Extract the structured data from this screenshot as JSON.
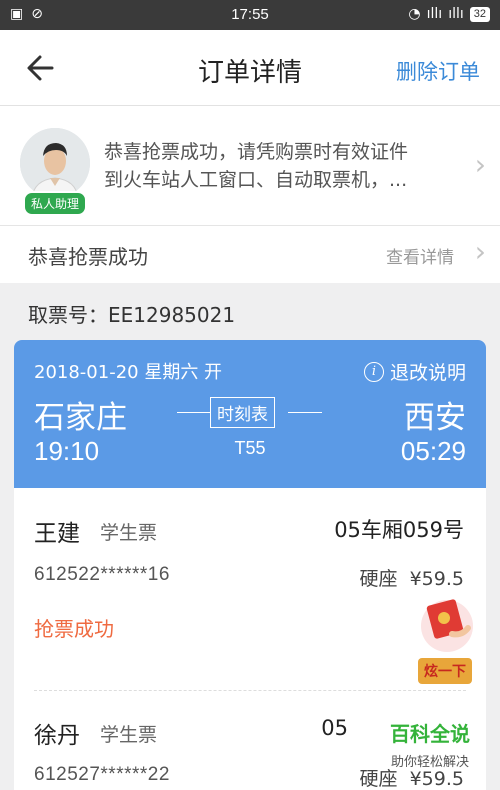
{
  "status_bar": {
    "time": "17:55",
    "battery": "32",
    "left_icons": [
      "image-icon",
      "mute-icon"
    ],
    "right_icons": [
      "wifi-icon",
      "signal-icon",
      "signal-icon"
    ],
    "signal_1": "ıllı",
    "signal_2": "ıllı"
  },
  "header": {
    "title": "订单详情",
    "action": "删除订单"
  },
  "assistant": {
    "badge": "私人助理",
    "message_line1": "恭喜抢票成功，请凭购票时有效证件",
    "message_line2": "到火车站人工窗口、自动取票机，..."
  },
  "status_row": {
    "label": "恭喜抢票成功",
    "detail": "查看详情"
  },
  "ticket": {
    "number": "取票号：EE12985021",
    "date": "2018-01-20 星期六 开",
    "refund": "退改说明",
    "from_station": "石家庄",
    "to_station": "西安",
    "depart_time": "19:10",
    "arrive_time": "05:29",
    "schedule_btn": "时刻表",
    "train_no": "T55"
  },
  "passengers": [
    {
      "name": "王建",
      "type": "学生票",
      "seat": "05车厢059号",
      "id": "612522******16",
      "class_price": "硬座  ¥59.5",
      "status": "抢票成功"
    },
    {
      "name": "徐丹",
      "type": "学生票",
      "seat": "05",
      "id": "612527******22",
      "class_price": "硬座  ¥59.5"
    }
  ],
  "promo": {
    "label": "炫一下"
  },
  "watermark": {
    "title": "百科全说",
    "subtitle": "助你轻松解决"
  },
  "colors": {
    "accent": "#3b8ad8",
    "card": "#5b9ae6",
    "status": "#ef6a40",
    "badge": "#2fa84f"
  }
}
